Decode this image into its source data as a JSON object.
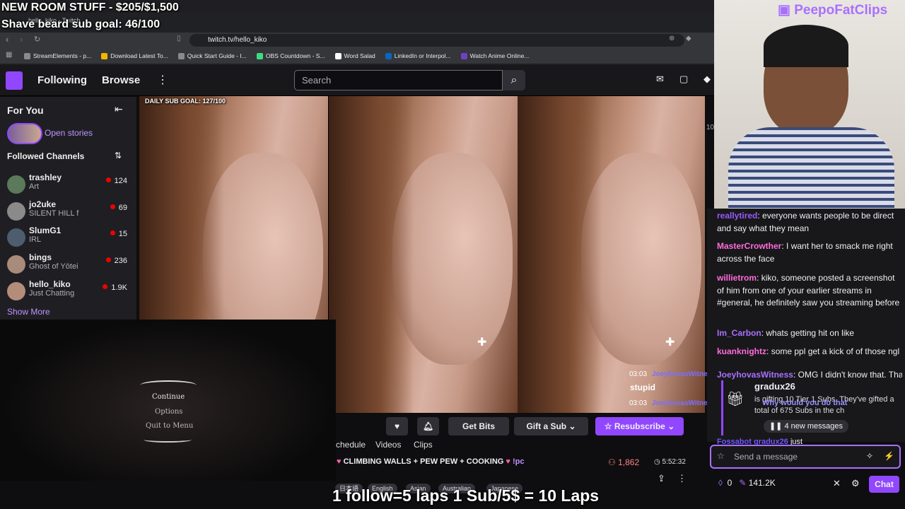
{
  "overlay": {
    "room_goal": "NEW ROOM STUFF - $205/$1,500",
    "beard_goal": "Shave beard sub goal: 46/100",
    "laps": "1 follow=5 laps 1 Sub/5$ = 10 Laps",
    "clip_brand": "PeepoFatClips",
    "daily_goal": "DAILY SUB GOAL: 127/100"
  },
  "browser": {
    "tab_title": "hello_kiko - Twitch",
    "url": "twitch.tv/hello_kiko",
    "bookmarks": [
      "StreamElements - p...",
      "Download Latest To...",
      "Quick Start Guide - I...",
      "OBS Countdown - S...",
      "Word Salad",
      "LinkedIn or Interpol...",
      "Watch Anime Online..."
    ]
  },
  "twitch_nav": {
    "following": "Following",
    "browse": "Browse",
    "search_placeholder": "Search"
  },
  "sidebar": {
    "for_you": "For You",
    "open_stories": "Open stories",
    "followed": "Followed Channels",
    "channels": [
      {
        "name": "trashley",
        "game": "Art",
        "viewers": "124"
      },
      {
        "name": "jo2uke",
        "game": "SILENT HILL f",
        "viewers": "69"
      },
      {
        "name": "SlumG1",
        "game": "IRL",
        "viewers": "15"
      },
      {
        "name": "bings",
        "game": "Ghost of Yōtei",
        "viewers": "236"
      },
      {
        "name": "hello_kiko",
        "game": "Just Chatting",
        "viewers": "1.9K"
      }
    ],
    "show_more": "Show More"
  },
  "game_menu": {
    "continue": "Continue",
    "options": "Options",
    "quit": "Quit to Menu"
  },
  "chat": {
    "messages": [
      {
        "user": "reallytired",
        "text": "everyone wants people to be direct and say what they mean",
        "color": "#9b59ff"
      },
      {
        "user": "MasterCrowther",
        "text": "I want her to smack me right across the face",
        "color": "#ff6bdb"
      },
      {
        "user": "willietrom",
        "text": "kiko, someone posted a screenshot of him from one of your earlier streams in #general, he definitely saw you streaming before",
        "color": "#ff6bdb"
      },
      {
        "user": "Im_Carbon",
        "text": "whats getting hit on like",
        "color": "#a970ff"
      },
      {
        "user": "kuanknightz",
        "text": "some ppl get a kick of of those ngl",
        "color": "#ff6bdb"
      },
      {
        "user": "JoeyhovasWitness",
        "text": "OMG I didn't know that. That is",
        "color": "#a970ff"
      }
    ],
    "overlay_chat": [
      {
        "time": "03:03",
        "user": "JoeyhovasWitness",
        "text": "stupid"
      },
      {
        "time": "03:03",
        "user": "JoeyhovasWitness",
        "text": "Why would you do that"
      }
    ],
    "gift_user": "gradux26",
    "gift_text": "is gifting 10 Tier 1 Subs. They've gifted a total of 675 Subs in the ch",
    "new_messages": "4 new messages",
    "cut_user": "Fossabot",
    "cut_user2": "gradux26",
    "cut_text": "just",
    "send_placeholder": "Send a message",
    "points": "0",
    "points2": "141.2K",
    "chat_button": "Chat",
    "side_count": "10"
  },
  "stream": {
    "get_bits": "Get Bits",
    "gift_sub": "Gift a Sub",
    "resubscribe": "Resubscribe",
    "tabs": [
      "chedule",
      "Videos",
      "Clips"
    ],
    "title": "CLIMBING WALLS + PEW PEW + COOKING",
    "title_suffix": "!pc",
    "viewers": "1,862",
    "uptime": "5:52:32",
    "tags": [
      "日本語",
      "English",
      "Asian",
      "Australian",
      "Japanese"
    ]
  },
  "colors": {
    "accent": "#9147ff",
    "live": "#eb0400"
  }
}
